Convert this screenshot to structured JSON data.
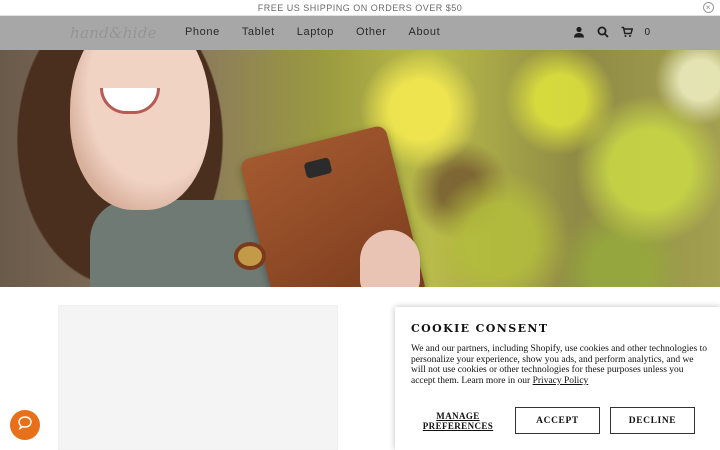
{
  "announcement": {
    "text": "FREE US SHIPPING ON ORDERS OVER $50",
    "close_icon": "close-icon"
  },
  "header": {
    "logo_text": "hand&hide",
    "nav": [
      {
        "label": "Phone"
      },
      {
        "label": "Tablet"
      },
      {
        "label": "Laptop"
      },
      {
        "label": "Other"
      },
      {
        "label": "About"
      }
    ],
    "icons": [
      "user-icon",
      "search-icon",
      "cart-icon"
    ],
    "cart_count": "0"
  },
  "hero": {
    "image": "woman-holding-leather-phone-case"
  },
  "cookie": {
    "title": "COOKIE CONSENT",
    "body": "We and our partners, including Shopify, use cookies and other technologies to personalize your experience, show you ads, and perform analytics, and we will not use cookies or other technologies for these purposes unless you accept them. Learn more in our ",
    "link": "Privacy Policy",
    "manage_label_line1": "MANAGE",
    "manage_label_line2": "PREFERENCES",
    "accept_label": "ACCEPT",
    "decline_label": "DECLINE"
  },
  "chat": {
    "icon": "chat-bubble-icon",
    "color": "#e8701a"
  }
}
